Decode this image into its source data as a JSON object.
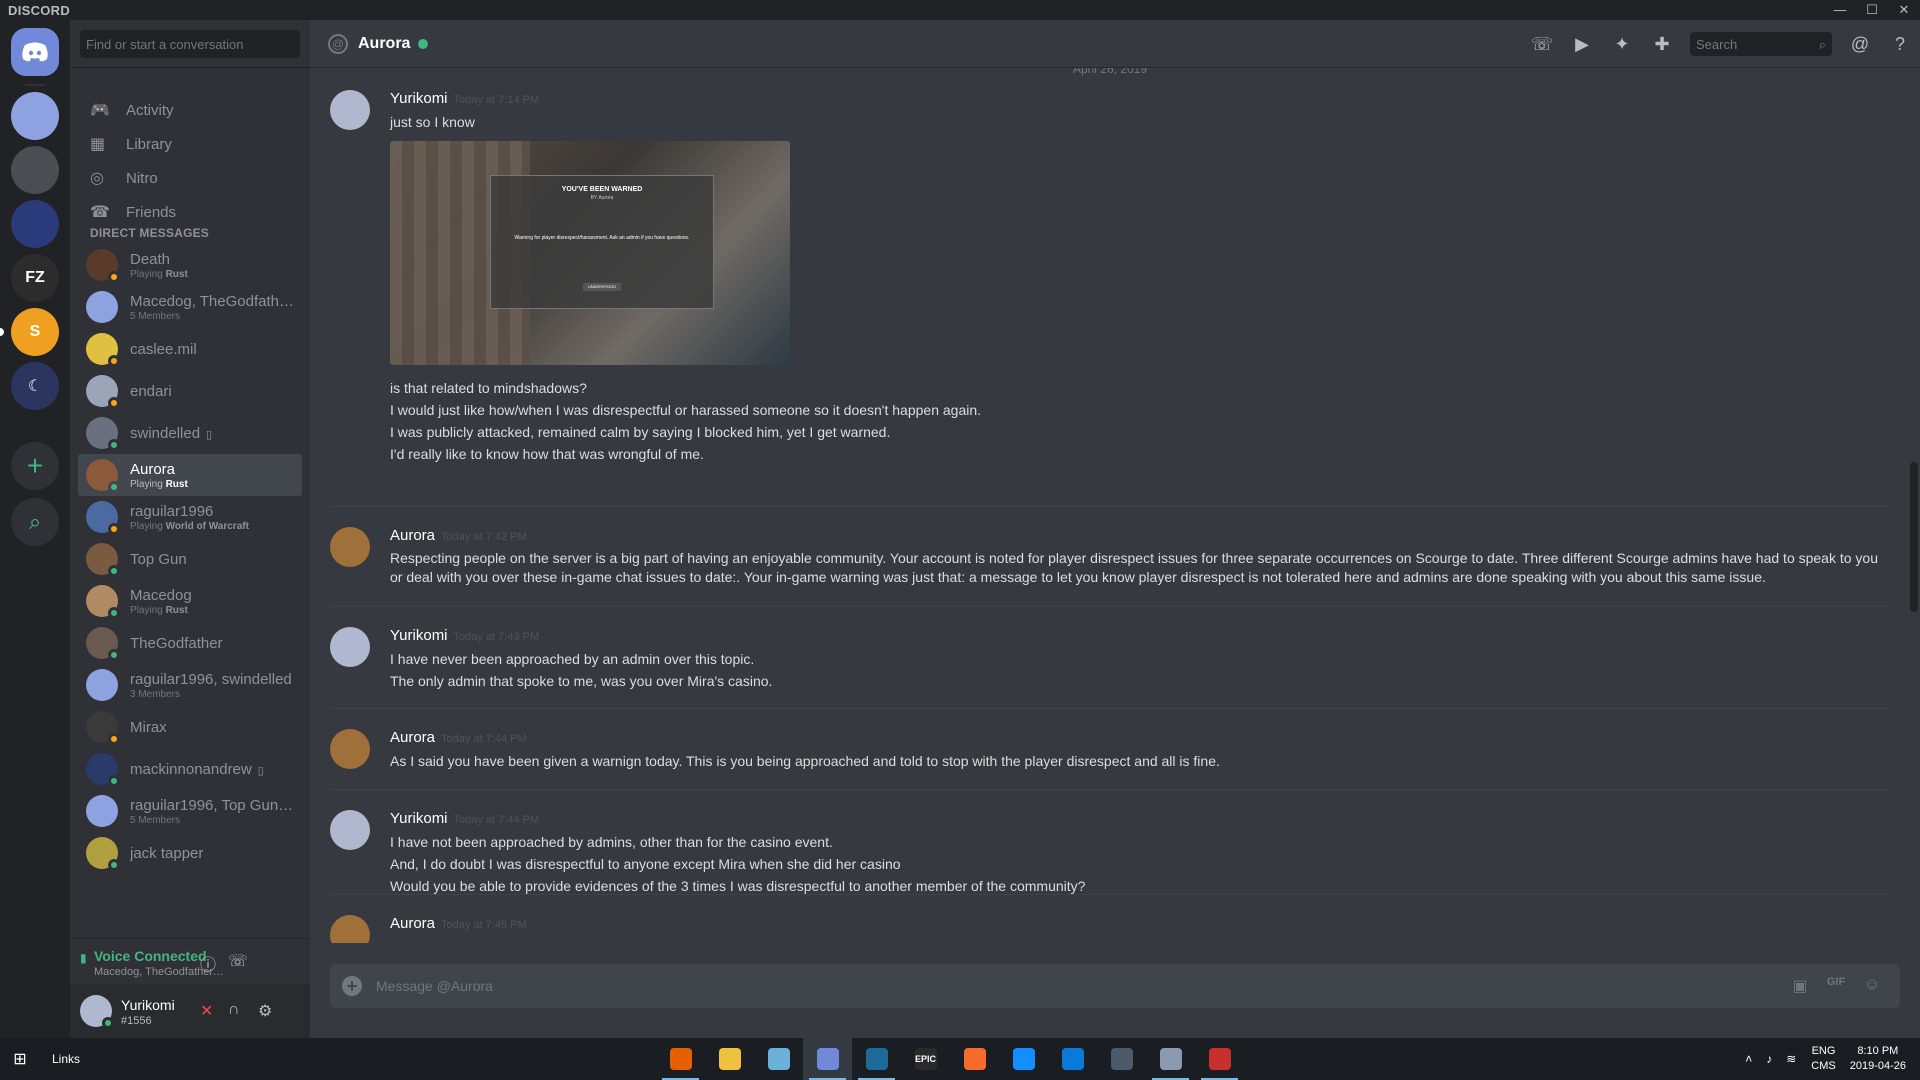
{
  "window": {
    "title": "DISCORD",
    "controls": [
      "—",
      "☐",
      "✕"
    ]
  },
  "rail": {
    "servers": [
      {
        "name": "home",
        "label": "",
        "bg": "#7289da"
      },
      {
        "name": "group-dm",
        "label": "",
        "bg": "#8ea1e1"
      },
      {
        "name": "server-triangle",
        "label": "",
        "bg": "#4a4d52"
      },
      {
        "name": "server-night",
        "label": "",
        "bg": "#2a3a7a"
      },
      {
        "name": "server-fz",
        "label": "FZ",
        "bg": "#2c2c2c"
      },
      {
        "name": "server-s",
        "label": "S",
        "bg": "#f0a020"
      },
      {
        "name": "server-moon",
        "label": "☾",
        "bg": "#2b3560"
      }
    ],
    "add_label": "+",
    "search_label": "⌕"
  },
  "dm_sidebar": {
    "search_placeholder": "Find or start a conversation",
    "nav": [
      {
        "label": "Activity",
        "icon": "🎮"
      },
      {
        "label": "Library",
        "icon": "▦"
      },
      {
        "label": "Nitro",
        "icon": "◎"
      },
      {
        "label": "Friends",
        "icon": "☎"
      }
    ],
    "header": "DIRECT MESSAGES",
    "dms": [
      {
        "name": "Death",
        "sub_prefix": "Playing ",
        "sub_bold": "Rust",
        "status": "#faa61a",
        "avatar": "#5a3a2a",
        "active": false,
        "mobile": false
      },
      {
        "name": "Macedog, TheGodfathe...",
        "sub_prefix": "5 Members",
        "sub_bold": "",
        "status": "",
        "avatar": "#8ea1e1",
        "active": false,
        "mobile": false
      },
      {
        "name": "caslee.mil",
        "sub_prefix": "",
        "sub_bold": "",
        "status": "#faa61a",
        "avatar": "#e0c040",
        "active": false,
        "mobile": false
      },
      {
        "name": "endari",
        "sub_prefix": "",
        "sub_bold": "",
        "status": "#faa61a",
        "avatar": "#9aa6b8",
        "active": false,
        "mobile": false
      },
      {
        "name": "swindelled",
        "sub_prefix": "",
        "sub_bold": "",
        "status": "#43b581",
        "avatar": "#6a7080",
        "active": false,
        "mobile": true
      },
      {
        "name": "Aurora",
        "sub_prefix": "Playing ",
        "sub_bold": "Rust",
        "status": "#43b581",
        "avatar": "#8a5a3a",
        "active": true,
        "mobile": false
      },
      {
        "name": "raguilar1996",
        "sub_prefix": "Playing ",
        "sub_bold": "World of Warcraft",
        "status": "#faa61a",
        "avatar": "#4a6aa0",
        "active": false,
        "mobile": false
      },
      {
        "name": "Top Gun",
        "sub_prefix": "",
        "sub_bold": "",
        "status": "#43b581",
        "avatar": "#7a5a40",
        "active": false,
        "mobile": false
      },
      {
        "name": "Macedog",
        "sub_prefix": "Playing ",
        "sub_bold": "Rust",
        "status": "#43b581",
        "avatar": "#b08a60",
        "active": false,
        "mobile": false
      },
      {
        "name": "TheGodfather",
        "sub_prefix": "",
        "sub_bold": "",
        "status": "#43b581",
        "avatar": "#6a5a50",
        "active": false,
        "mobile": false
      },
      {
        "name": "raguilar1996, swindelled",
        "sub_prefix": "3 Members",
        "sub_bold": "",
        "status": "",
        "avatar": "#8ea1e1",
        "active": false,
        "mobile": false
      },
      {
        "name": "Mirax",
        "sub_prefix": "",
        "sub_bold": "",
        "status": "#faa61a",
        "avatar": "#3a3a3a",
        "active": false,
        "mobile": false
      },
      {
        "name": "mackinnonandrew",
        "sub_prefix": "",
        "sub_bold": "",
        "status": "#43b581",
        "avatar": "#2a3a6a",
        "active": false,
        "mobile": true
      },
      {
        "name": "raguilar1996, Top Gun, ...",
        "sub_prefix": "5 Members",
        "sub_bold": "",
        "status": "",
        "avatar": "#8ea1e1",
        "active": false,
        "mobile": false
      },
      {
        "name": "jack tapper",
        "sub_prefix": "",
        "sub_bold": "",
        "status": "#43b581",
        "avatar": "#b0a040",
        "active": false,
        "mobile": false
      }
    ],
    "voice": {
      "status": "Voice Connected",
      "channel": "Macedog, TheGodfather, swi..."
    },
    "user": {
      "name": "Yurikomi",
      "tag": "#1556"
    }
  },
  "chat": {
    "channel_name": "Aurora",
    "search_placeholder": "Search",
    "date_divider": "April 26, 2019",
    "input_placeholder": "Message @Aurora",
    "attachment": {
      "title": "YOU'VE BEEN WARNED",
      "by": "BY Aurora",
      "reason": "Warning for player disrespect/harassment. Ask an admin if you have questions.",
      "button": "UNDERSTOOD"
    },
    "messages": [
      {
        "author": "Yurikomi",
        "time": "Today at 7:14 PM",
        "avatar": "#b0b8d0",
        "lines_before": [
          "just so I know"
        ],
        "has_attachment": true,
        "lines": [
          "is that related to mindshadows?",
          "I would just like how/when I was disrespectful or harassed someone so it doesn't happen again.",
          "I was publicly attacked, remained calm by saying I blocked him, yet I get warned.",
          "I'd really like to know how that was wrongful of me."
        ]
      },
      {
        "author": "Aurora",
        "time": "Today at 7:42 PM",
        "avatar": "#a0703a",
        "lines_before": [],
        "has_attachment": false,
        "lines": [
          "Respecting people on the server is a big part of having an enjoyable community. Your account is noted for player disrespect issues for three separate occurrences on Scourge to date.  Three  different Scourge admins have had to speak to you or deal with you over these in-game chat issues to date:. Your in-game warning was just that: a message to let you know player disrespect is not tolerated here and admins are done speaking with you about this same issue."
        ]
      },
      {
        "author": "Yurikomi",
        "time": "Today at 7:43 PM",
        "avatar": "#b0b8d0",
        "lines_before": [],
        "has_attachment": false,
        "lines": [
          "I have never been approached by an admin over this topic.",
          "The only admin that spoke to me, was you over Mira's casino."
        ]
      },
      {
        "author": "Aurora",
        "time": "Today at 7:44 PM",
        "avatar": "#a0703a",
        "lines_before": [],
        "has_attachment": false,
        "lines": [
          "As I said you have been given a warnign today. This is you being approached and told to stop with the player disrespect and all is fine."
        ]
      },
      {
        "author": "Yurikomi",
        "time": "Today at 7:44 PM",
        "avatar": "#b0b8d0",
        "lines_before": [],
        "has_attachment": false,
        "lines": [
          "I have not been approached by admins, other than for the casino event.",
          "And, I do doubt I was disrespectful to anyone except Mira when she did her casino",
          "Would you be able to provide evidences of the 3 times I was disrespectful to another member of the community?"
        ]
      },
      {
        "author": "Aurora",
        "time": "Today at 7:45 PM",
        "avatar": "#a0703a",
        "lines_before": [],
        "has_attachment": false,
        "lines": []
      }
    ]
  },
  "taskbar": {
    "links_label": "Links",
    "apps": [
      {
        "name": "firefox",
        "label": "",
        "color": "#e66000",
        "running": true,
        "focused": false
      },
      {
        "name": "file-explorer",
        "label": "",
        "color": "#f0c040",
        "running": false,
        "focused": false
      },
      {
        "name": "notes",
        "label": "",
        "color": "#6ab0d8",
        "running": false,
        "focused": false
      },
      {
        "name": "discord",
        "label": "",
        "color": "#7289da",
        "running": true,
        "focused": true
      },
      {
        "name": "steam",
        "label": "",
        "color": "#1b6a9a",
        "running": true,
        "focused": false
      },
      {
        "name": "epic-games",
        "label": "EPIC",
        "color": "#2a2a2a",
        "running": false,
        "focused": false
      },
      {
        "name": "origin",
        "label": "",
        "color": "#f56c2d",
        "running": false,
        "focused": false
      },
      {
        "name": "battle-net",
        "label": "",
        "color": "#148eff",
        "running": false,
        "focused": false
      },
      {
        "name": "uplay",
        "label": "",
        "color": "#0a7ad8",
        "running": false,
        "focused": false
      },
      {
        "name": "water-drop",
        "label": "",
        "color": "#4a5a6a",
        "running": false,
        "focused": false
      },
      {
        "name": "remote-desktop",
        "label": "",
        "color": "#8a9ab0",
        "running": true,
        "focused": false
      },
      {
        "name": "rust",
        "label": "",
        "color": "#c83030",
        "running": true,
        "focused": false
      }
    ],
    "tray": {
      "lang_top": "ENG",
      "lang_bottom": "CMS",
      "time": "8:10 PM",
      "date": "2019-04-26"
    }
  }
}
